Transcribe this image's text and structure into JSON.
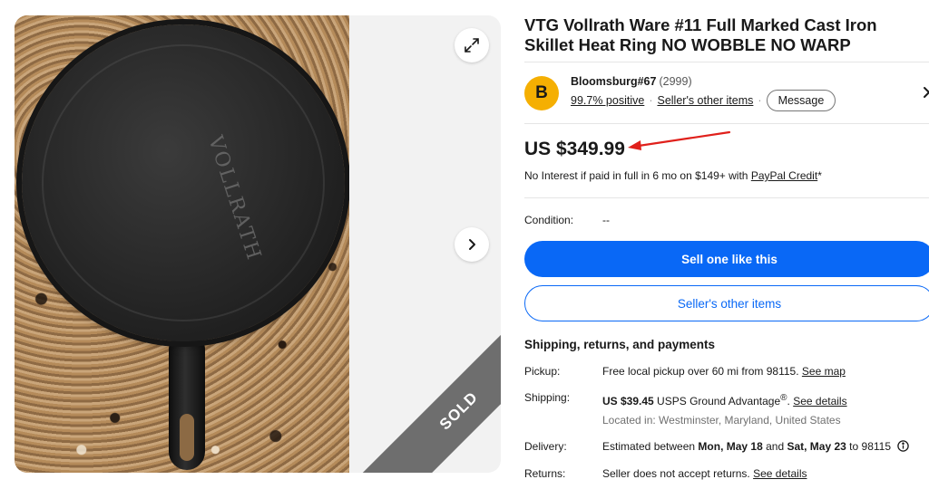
{
  "listing": {
    "title": "VTG Vollrath Ware #11 Full Marked Cast Iron Skillet Heat Ring NO WOBBLE NO WARP",
    "sold_label": "SOLD",
    "pan_marking": "VOLLRATH"
  },
  "seller": {
    "avatar_letter": "B",
    "name": "Bloomsburg#67",
    "feedback_count": "(2999)",
    "positive": "99.7% positive",
    "other_items_link": "Seller's other items",
    "message_label": "Message"
  },
  "price": {
    "amount": "US $349.99",
    "credit_text": "No Interest if paid in full in 6 mo on $149+ with ",
    "credit_link": "PayPal Credit",
    "credit_suffix": "*"
  },
  "condition": {
    "label": "Condition:",
    "value": "--"
  },
  "actions": {
    "primary": "Sell one like this",
    "secondary": "Seller's other items"
  },
  "shipping": {
    "heading": "Shipping, returns, and payments",
    "pickup_label": "Pickup:",
    "pickup_text": "Free local pickup over 60 mi from 98115.",
    "pickup_link": "See map",
    "shipping_label": "Shipping:",
    "shipping_cost": "US $39.45",
    "shipping_service": " USPS Ground Advantage",
    "shipping_reg": "®",
    "shipping_link": "See details",
    "location": "Located in: Westminster, Maryland, United States",
    "delivery_label": "Delivery:",
    "delivery_prefix": "Estimated between ",
    "delivery_start": "Mon, May 18",
    "delivery_and": " and ",
    "delivery_end": "Sat, May 23",
    "delivery_suffix": " to 98115",
    "returns_label": "Returns:",
    "returns_text": "Seller does not accept returns.",
    "returns_link": "See details"
  },
  "colors": {
    "primary_blue": "#0968f6",
    "avatar_yellow": "#f5af02",
    "annotation_red": "#e0201b",
    "sold_ribbon": "#6e6e6e"
  },
  "icons": [
    "expand-icon",
    "chevron-right-icon",
    "info-icon",
    "annotation-arrow"
  ]
}
